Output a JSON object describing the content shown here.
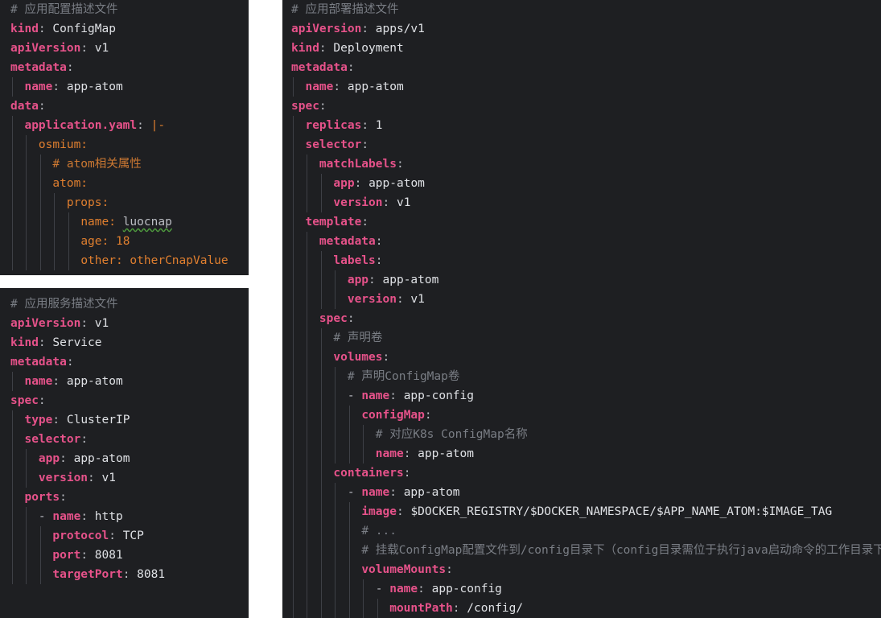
{
  "configmap_panel": {
    "lines": [
      {
        "t": [
          [
            "c",
            "# 应用配置描述文件"
          ]
        ]
      },
      {
        "t": [
          [
            "k",
            "kind"
          ],
          [
            "p",
            ": "
          ],
          [
            "v",
            "ConfigMap"
          ]
        ]
      },
      {
        "t": [
          [
            "k",
            "apiVersion"
          ],
          [
            "p",
            ": "
          ],
          [
            "v",
            "v1"
          ]
        ]
      },
      {
        "t": [
          [
            "k",
            "metadata"
          ],
          [
            "p",
            ":"
          ]
        ]
      },
      {
        "t": [
          [
            "p",
            "  "
          ],
          [
            "k",
            "name"
          ],
          [
            "p",
            ": "
          ],
          [
            "v",
            "app-atom"
          ]
        ]
      },
      {
        "t": [
          [
            "k",
            "data"
          ],
          [
            "p",
            ":"
          ]
        ]
      },
      {
        "t": [
          [
            "p",
            "  "
          ],
          [
            "k",
            "application.yaml"
          ],
          [
            "p",
            ": "
          ],
          [
            "b",
            "|-"
          ]
        ]
      },
      {
        "t": [
          [
            "p",
            "    "
          ],
          [
            "b",
            "osmium:"
          ]
        ]
      },
      {
        "t": [
          [
            "p",
            "      "
          ],
          [
            "cb",
            "# atom相关属性"
          ]
        ]
      },
      {
        "t": [
          [
            "p",
            "      "
          ],
          [
            "b",
            "atom:"
          ]
        ]
      },
      {
        "t": [
          [
            "p",
            "        "
          ],
          [
            "b",
            "props:"
          ]
        ]
      },
      {
        "t": [
          [
            "p",
            "          "
          ],
          [
            "b",
            "name: "
          ],
          [
            "u",
            "luocnap"
          ]
        ]
      },
      {
        "t": [
          [
            "p",
            "          "
          ],
          [
            "b",
            "age: 18"
          ]
        ]
      },
      {
        "t": [
          [
            "p",
            "          "
          ],
          [
            "b",
            "other: otherCnapValue"
          ]
        ]
      }
    ]
  },
  "service_panel": {
    "lines": [
      {
        "t": [
          [
            "c",
            "# 应用服务描述文件"
          ]
        ]
      },
      {
        "t": [
          [
            "k",
            "apiVersion"
          ],
          [
            "p",
            ": "
          ],
          [
            "v",
            "v1"
          ]
        ]
      },
      {
        "t": [
          [
            "k",
            "kind"
          ],
          [
            "p",
            ": "
          ],
          [
            "v",
            "Service"
          ]
        ]
      },
      {
        "t": [
          [
            "k",
            "metadata"
          ],
          [
            "p",
            ":"
          ]
        ]
      },
      {
        "t": [
          [
            "p",
            "  "
          ],
          [
            "k",
            "name"
          ],
          [
            "p",
            ": "
          ],
          [
            "v",
            "app-atom"
          ]
        ]
      },
      {
        "t": [
          [
            "k",
            "spec"
          ],
          [
            "p",
            ":"
          ]
        ]
      },
      {
        "t": [
          [
            "p",
            "  "
          ],
          [
            "k",
            "type"
          ],
          [
            "p",
            ": "
          ],
          [
            "v",
            "ClusterIP"
          ]
        ]
      },
      {
        "t": [
          [
            "p",
            "  "
          ],
          [
            "k",
            "selector"
          ],
          [
            "p",
            ":"
          ]
        ]
      },
      {
        "t": [
          [
            "p",
            "    "
          ],
          [
            "k",
            "app"
          ],
          [
            "p",
            ": "
          ],
          [
            "v",
            "app-atom"
          ]
        ]
      },
      {
        "t": [
          [
            "p",
            "    "
          ],
          [
            "k",
            "version"
          ],
          [
            "p",
            ": "
          ],
          [
            "v",
            "v1"
          ]
        ]
      },
      {
        "t": [
          [
            "p",
            "  "
          ],
          [
            "k",
            "ports"
          ],
          [
            "p",
            ":"
          ]
        ]
      },
      {
        "t": [
          [
            "p",
            "    - "
          ],
          [
            "k",
            "name"
          ],
          [
            "p",
            ": "
          ],
          [
            "v",
            "http"
          ]
        ]
      },
      {
        "t": [
          [
            "p",
            "      "
          ],
          [
            "k",
            "protocol"
          ],
          [
            "p",
            ": "
          ],
          [
            "v",
            "TCP"
          ]
        ]
      },
      {
        "t": [
          [
            "p",
            "      "
          ],
          [
            "k",
            "port"
          ],
          [
            "p",
            ": "
          ],
          [
            "v",
            "8081"
          ]
        ]
      },
      {
        "t": [
          [
            "p",
            "      "
          ],
          [
            "k",
            "targetPort"
          ],
          [
            "p",
            ": "
          ],
          [
            "v",
            "8081"
          ]
        ]
      }
    ]
  },
  "deployment_panel": {
    "lines": [
      {
        "t": [
          [
            "c",
            "# 应用部署描述文件"
          ]
        ]
      },
      {
        "t": [
          [
            "k",
            "apiVersion"
          ],
          [
            "p",
            ": "
          ],
          [
            "v",
            "apps/v1"
          ]
        ]
      },
      {
        "t": [
          [
            "k",
            "kind"
          ],
          [
            "p",
            ": "
          ],
          [
            "v",
            "Deployment"
          ]
        ]
      },
      {
        "t": [
          [
            "k",
            "metadata"
          ],
          [
            "p",
            ":"
          ]
        ]
      },
      {
        "t": [
          [
            "p",
            "  "
          ],
          [
            "k",
            "name"
          ],
          [
            "p",
            ": "
          ],
          [
            "v",
            "app-atom"
          ]
        ]
      },
      {
        "t": [
          [
            "k",
            "spec"
          ],
          [
            "p",
            ":"
          ]
        ]
      },
      {
        "t": [
          [
            "p",
            "  "
          ],
          [
            "k",
            "replicas"
          ],
          [
            "p",
            ": "
          ],
          [
            "v",
            "1"
          ]
        ]
      },
      {
        "t": [
          [
            "p",
            "  "
          ],
          [
            "k",
            "selector"
          ],
          [
            "p",
            ":"
          ]
        ]
      },
      {
        "t": [
          [
            "p",
            "    "
          ],
          [
            "k",
            "matchLabels"
          ],
          [
            "p",
            ":"
          ]
        ]
      },
      {
        "t": [
          [
            "p",
            "      "
          ],
          [
            "k",
            "app"
          ],
          [
            "p",
            ": "
          ],
          [
            "v",
            "app-atom"
          ]
        ]
      },
      {
        "t": [
          [
            "p",
            "      "
          ],
          [
            "k",
            "version"
          ],
          [
            "p",
            ": "
          ],
          [
            "v",
            "v1"
          ]
        ]
      },
      {
        "t": [
          [
            "p",
            "  "
          ],
          [
            "k",
            "template"
          ],
          [
            "p",
            ":"
          ]
        ]
      },
      {
        "t": [
          [
            "p",
            "    "
          ],
          [
            "k",
            "metadata"
          ],
          [
            "p",
            ":"
          ]
        ]
      },
      {
        "t": [
          [
            "p",
            "      "
          ],
          [
            "k",
            "labels"
          ],
          [
            "p",
            ":"
          ]
        ]
      },
      {
        "t": [
          [
            "p",
            "        "
          ],
          [
            "k",
            "app"
          ],
          [
            "p",
            ": "
          ],
          [
            "v",
            "app-atom"
          ]
        ]
      },
      {
        "t": [
          [
            "p",
            "        "
          ],
          [
            "k",
            "version"
          ],
          [
            "p",
            ": "
          ],
          [
            "v",
            "v1"
          ]
        ]
      },
      {
        "t": [
          [
            "p",
            "    "
          ],
          [
            "k",
            "spec"
          ],
          [
            "p",
            ":"
          ]
        ]
      },
      {
        "t": [
          [
            "p",
            "      "
          ],
          [
            "c",
            "# 声明卷"
          ]
        ]
      },
      {
        "t": [
          [
            "p",
            "      "
          ],
          [
            "k",
            "volumes"
          ],
          [
            "p",
            ":"
          ]
        ]
      },
      {
        "t": [
          [
            "p",
            "        "
          ],
          [
            "c",
            "# 声明ConfigMap卷"
          ]
        ]
      },
      {
        "t": [
          [
            "p",
            "        - "
          ],
          [
            "k",
            "name"
          ],
          [
            "p",
            ": "
          ],
          [
            "v",
            "app-config"
          ]
        ]
      },
      {
        "t": [
          [
            "p",
            "          "
          ],
          [
            "k",
            "configMap"
          ],
          [
            "p",
            ":"
          ]
        ]
      },
      {
        "t": [
          [
            "p",
            "            "
          ],
          [
            "c",
            "# 对应K8s ConfigMap名称"
          ]
        ]
      },
      {
        "t": [
          [
            "p",
            "            "
          ],
          [
            "k",
            "name"
          ],
          [
            "p",
            ": "
          ],
          [
            "v",
            "app-atom"
          ]
        ]
      },
      {
        "t": [
          [
            "p",
            "      "
          ],
          [
            "k",
            "containers"
          ],
          [
            "p",
            ":"
          ]
        ]
      },
      {
        "t": [
          [
            "p",
            "        - "
          ],
          [
            "k",
            "name"
          ],
          [
            "p",
            ": "
          ],
          [
            "v",
            "app-atom"
          ]
        ]
      },
      {
        "t": [
          [
            "p",
            "          "
          ],
          [
            "k",
            "image"
          ],
          [
            "p",
            ": "
          ],
          [
            "v",
            "$DOCKER_REGISTRY/$DOCKER_NAMESPACE/$APP_NAME_ATOM:$IMAGE_TAG"
          ]
        ]
      },
      {
        "t": [
          [
            "p",
            "          "
          ],
          [
            "c",
            "# ..."
          ]
        ]
      },
      {
        "t": [
          [
            "p",
            "          "
          ],
          [
            "c",
            "# 挂载ConfigMap配置文件到/config目录下（config目录需位于执行java启动命令的工作目录下）"
          ]
        ]
      },
      {
        "t": [
          [
            "p",
            "          "
          ],
          [
            "k",
            "volumeMounts"
          ],
          [
            "p",
            ":"
          ]
        ]
      },
      {
        "t": [
          [
            "p",
            "            - "
          ],
          [
            "k",
            "name"
          ],
          [
            "p",
            ": "
          ],
          [
            "v",
            "app-config"
          ]
        ]
      },
      {
        "t": [
          [
            "p",
            "              "
          ],
          [
            "k",
            "mountPath"
          ],
          [
            "p",
            ": "
          ],
          [
            "v",
            "/config/"
          ]
        ]
      }
    ]
  }
}
